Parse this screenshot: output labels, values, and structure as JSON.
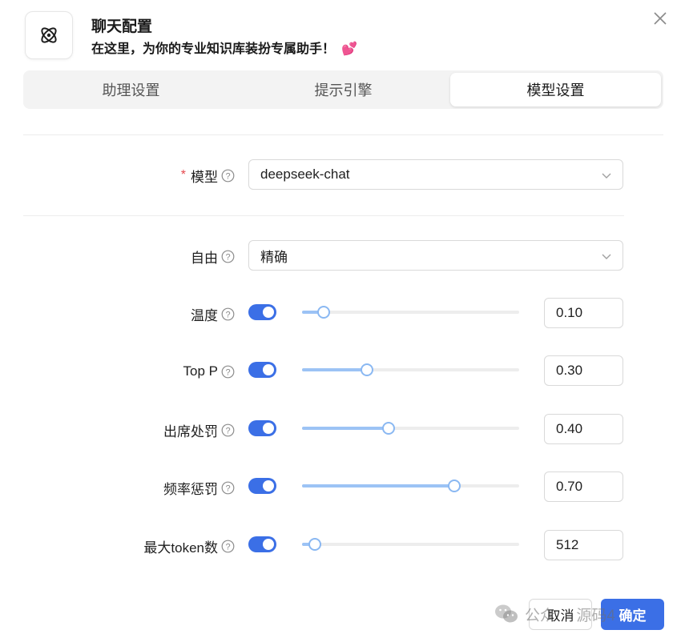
{
  "header": {
    "title": "聊天配置",
    "subtitle": "在这里，为你的专业知识库装扮专属助手！",
    "subtitle_emoji": "💕",
    "app_icon": "atom-icon",
    "close_icon": "close-icon"
  },
  "tabs": [
    {
      "label": "助理设置",
      "active": false
    },
    {
      "label": "提示引擎",
      "active": false
    },
    {
      "label": "模型设置",
      "active": true
    }
  ],
  "form": {
    "model": {
      "label": "模型",
      "required": true,
      "value": "deepseek-chat"
    },
    "freedom": {
      "label": "自由",
      "value": "精确"
    },
    "params": [
      {
        "label": "温度",
        "enabled": true,
        "fraction": 0.1,
        "value": "0.10"
      },
      {
        "label": "Top P",
        "enabled": true,
        "fraction": 0.3,
        "value": "0.30"
      },
      {
        "label": "出席处罚",
        "enabled": true,
        "fraction": 0.4,
        "value": "0.40"
      },
      {
        "label": "频率惩罚",
        "enabled": true,
        "fraction": 0.7,
        "value": "0.70"
      },
      {
        "label": "最大token数",
        "enabled": true,
        "fraction": 0.06,
        "value": "512"
      }
    ]
  },
  "footer": {
    "cancel_label": "取消",
    "ok_label": "确定"
  },
  "watermark": {
    "text_left": "公众",
    "dot": "·",
    "text_right": "源码4"
  },
  "colors": {
    "primary": "#3b6fe6",
    "slider_track": "#9cc3f5",
    "required": "#e5484d"
  }
}
